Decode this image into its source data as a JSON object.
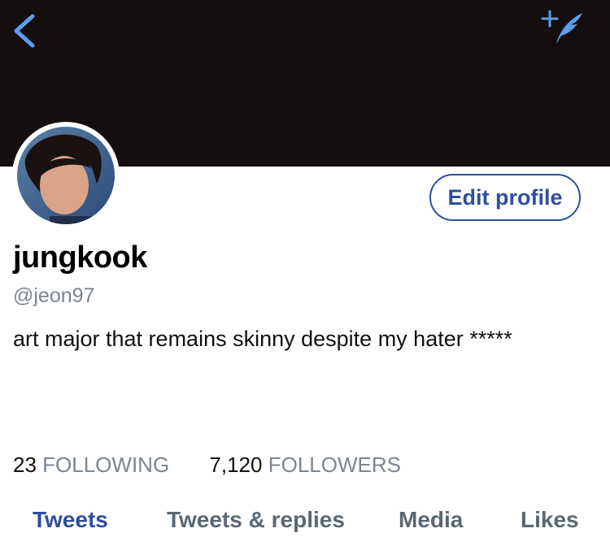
{
  "colors": {
    "banner": "#140e0f",
    "accent": "#2f4f9b",
    "icon_blue": "#5b9fec",
    "secondary_text": "#7b8691"
  },
  "header": {
    "back_icon": "chevron-left-icon",
    "compose_icon": "compose-tweet-icon"
  },
  "profile": {
    "avatar_icon": "avatar",
    "edit_button_label": "Edit profile",
    "display_name": "jungkook",
    "handle": "@jeon97",
    "bio": "art major that remains skinny despite my hater *****"
  },
  "stats": {
    "following_count": "23",
    "following_label": "FOLLOWING",
    "followers_count": "7,120",
    "followers_label": "FOLLOWERS"
  },
  "tabs": [
    {
      "label": "Tweets",
      "active": true
    },
    {
      "label": "Tweets & replies",
      "active": false
    },
    {
      "label": "Media",
      "active": false
    },
    {
      "label": "Likes",
      "active": false
    }
  ]
}
